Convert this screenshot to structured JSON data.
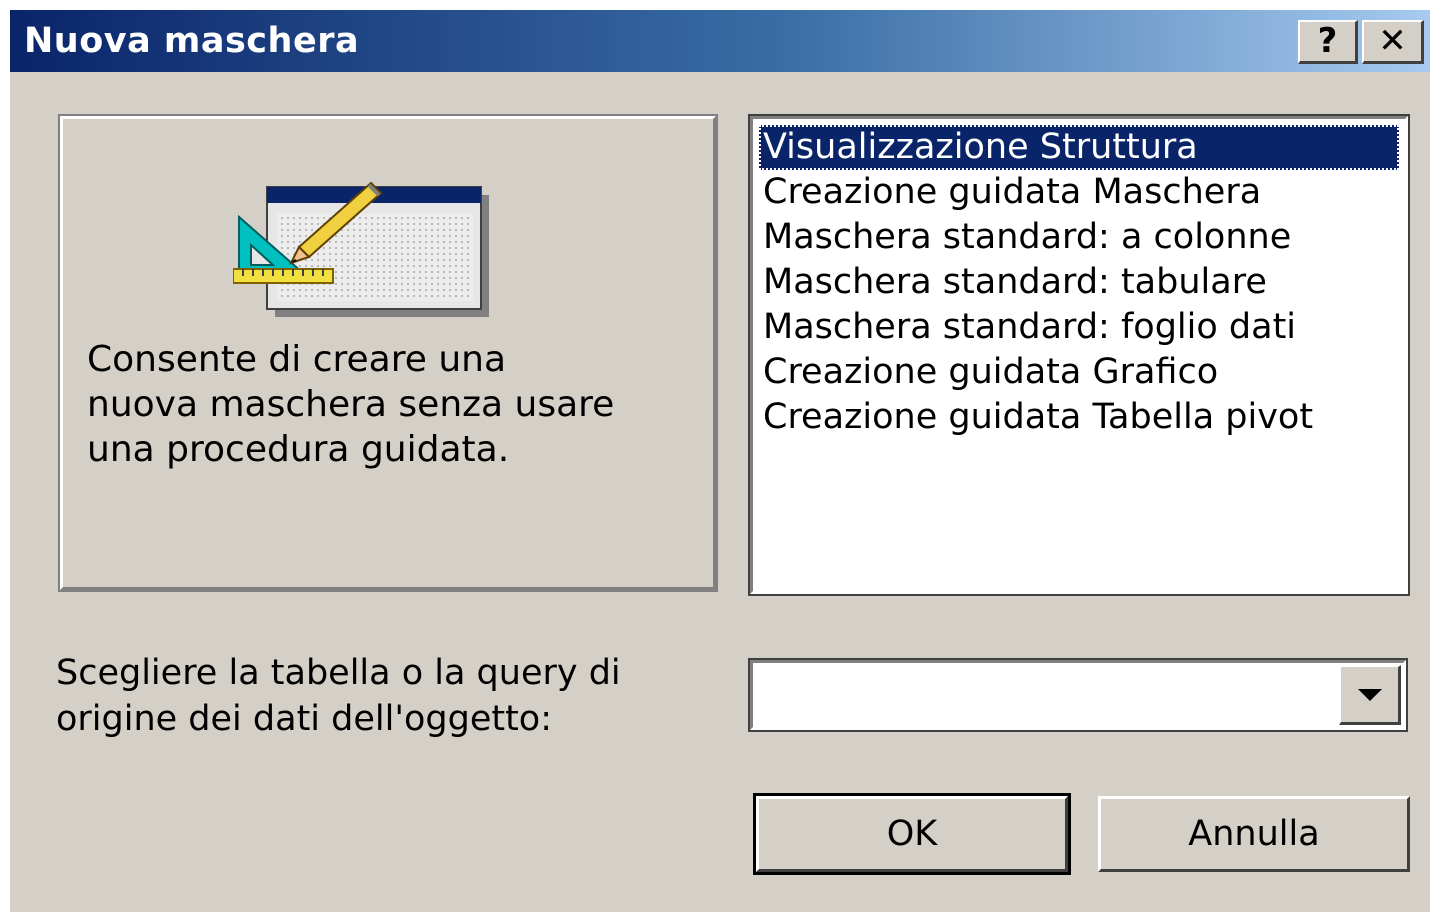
{
  "window": {
    "title": "Nuova maschera",
    "help_label": "?",
    "close_label": "✕"
  },
  "preview": {
    "icon": "form-design-icon",
    "description": "Consente di creare una\nnuova maschera senza usare\nuna procedura guidata."
  },
  "options": {
    "selected_index": 0,
    "items": [
      "Visualizzazione Struttura",
      "Creazione guidata Maschera",
      "Maschera standard: a colonne",
      "Maschera standard: tabulare",
      "Maschera standard: foglio dati",
      "Creazione guidata Grafico",
      "Creazione guidata Tabella pivot"
    ]
  },
  "source": {
    "label": "Scegliere la tabella o la query di\norigine dei dati dell'oggetto:",
    "value": ""
  },
  "buttons": {
    "ok": "OK",
    "cancel": "Annulla"
  },
  "colors": {
    "titlebar_start": "#0a246a",
    "titlebar_end": "#a6caf0",
    "dialog_face": "#d4d0c8",
    "selection": "#0a246a"
  }
}
